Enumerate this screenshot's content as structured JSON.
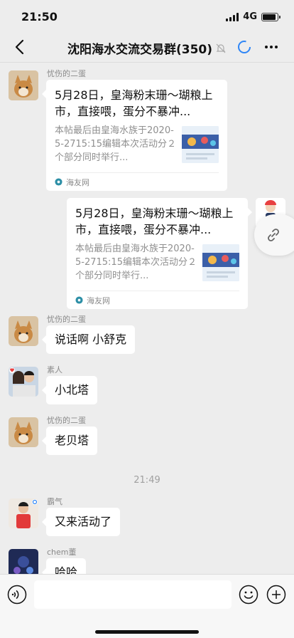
{
  "status_bar": {
    "time": "21:50",
    "network": "4G"
  },
  "header": {
    "title": "沈阳海水交流交易群(350)",
    "back_icon": "chevron-left-icon",
    "mute_icon": "bell-muted-icon",
    "more_icon": "more-dots-icon"
  },
  "messages": [
    {
      "type": "card",
      "sender": "忧伤的二蛋",
      "title": "5月28日，皇海粉末珊～瑚粮上市，直接喂，蛋分不暴冲...",
      "desc": "本帖最后由皇海水族于2020-5-2715:15编辑本次活动分２个部分同时举行...",
      "source": "海友网"
    },
    {
      "type": "card",
      "sender": "",
      "title": "5月28日，皇海粉末珊～瑚粮上市，直接喂，蛋分不暴冲...",
      "desc": "本帖最后由皇海水族于2020-5-2715:15编辑本次活动分２个部分同时举行...",
      "source": "海友网"
    },
    {
      "type": "text",
      "sender": "忧伤的二蛋",
      "text": "说话啊 小舒克"
    },
    {
      "type": "text",
      "sender": "素人",
      "text": "小北塔"
    },
    {
      "type": "text",
      "sender": "忧伤的二蛋",
      "text": "老贝塔"
    },
    {
      "type": "time",
      "text": "21:49"
    },
    {
      "type": "text",
      "sender": "霸气",
      "text": "又来活动了"
    },
    {
      "type": "text",
      "sender": "chem董",
      "text": "哈哈"
    }
  ],
  "input": {
    "placeholder": "",
    "value": ""
  },
  "colors": {
    "background": "#ededed",
    "bubble": "#ffffff",
    "accent": "#2f86f6"
  }
}
